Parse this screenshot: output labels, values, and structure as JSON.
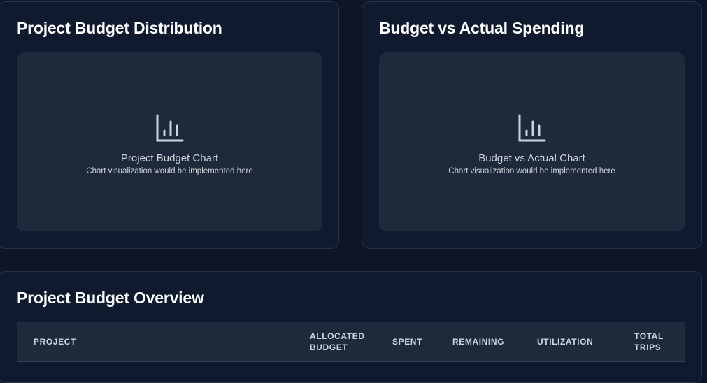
{
  "cards": {
    "budget_distribution": {
      "title": "Project Budget Distribution",
      "placeholder_title": "Project Budget Chart",
      "placeholder_subtitle": "Chart visualization would be implemented here",
      "icon": "bar-chart-icon"
    },
    "budget_vs_actual": {
      "title": "Budget vs Actual Spending",
      "placeholder_title": "Budget vs Actual Chart",
      "placeholder_subtitle": "Chart visualization would be implemented here",
      "icon": "bar-chart-icon"
    }
  },
  "overview": {
    "title": "Project Budget Overview",
    "columns": {
      "project": "PROJECT",
      "allocated": "ALLOCATED BUDGET",
      "spent": "SPENT",
      "remaining": "REMAINING",
      "utilization": "UTILIZATION",
      "trips": "TOTAL TRIPS"
    }
  },
  "colors": {
    "background": "#0d1526",
    "card": "#0f1a2e",
    "panel": "#1e293c",
    "text": "#ffffff",
    "muted": "#d1d5db"
  }
}
